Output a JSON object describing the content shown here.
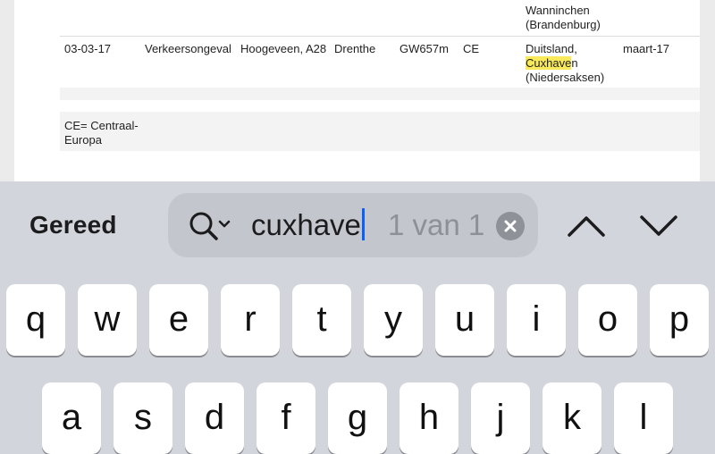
{
  "document": {
    "row_prev_city": "Wanninchen",
    "row_prev_region": "(Brandenburg)",
    "row": {
      "date": "03-03-17",
      "type": "Verkeersongeval",
      "location": "Hoogeveen, A28",
      "province": "Drenthe",
      "code": "GW657m",
      "region": "CE",
      "dest_country": "Duitsland,",
      "dest_city_highlight": "Cuxhave",
      "dest_city_rest": "n",
      "dest_region": "(Niedersaksen)",
      "month": "maart-17"
    },
    "footnote_line1": "CE= Centraal-",
    "footnote_line2": "Europa"
  },
  "findbar": {
    "done_label": "Gereed",
    "search_value": "cuxhave",
    "match_count": "1 van 1",
    "icons": [
      "search-icon",
      "clear-icon",
      "previous-match-icon",
      "next-match-icon"
    ]
  },
  "keyboard": {
    "row1": [
      "q",
      "w",
      "e",
      "r",
      "t",
      "y",
      "u",
      "i",
      "o",
      "p"
    ],
    "row2": [
      "a",
      "s",
      "d",
      "f",
      "g",
      "h",
      "j",
      "k",
      "l"
    ]
  },
  "colors": {
    "highlight": "#f8ea5a",
    "caret": "#0a60ff",
    "keyboard_bg": "#d2d5db"
  }
}
